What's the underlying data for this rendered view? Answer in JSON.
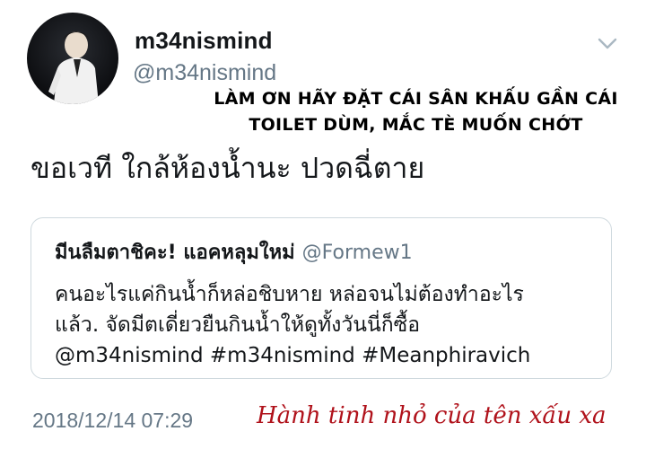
{
  "tweet": {
    "display_name": "m34nismind",
    "handle": "@m34nismind",
    "text": "ขอเวที ใกล้ห้องน้ำนะ ปวดฉี่ตาย",
    "timestamp": "2018/12/14 07:29",
    "avatar_icon": "profile-photo",
    "menu_icon": "chevron-down-icon"
  },
  "overlay": {
    "caption_line1": "LÀM ƠN HÃY ĐẶT CÁI SÂN KHẤU GẦN CÁI",
    "caption_line2": "TOILET DÙM, MẮC TÈ MUỐN CHỚT",
    "watermark": "Hành tinh nhỏ của tên xấu xa",
    "watermark_color": "#b0121b"
  },
  "quoted": {
    "name": "มีนลืมตาชิคะ! แอคหลุมใหม่",
    "handle": "@Formew1",
    "line1": "คนอะไรแค่กินน้ำก็หล่อชิบหาย หล่อจนไม่ต้องทำอะไร",
    "line2": "แล้ว. จัดมีตเดี่ยวยืนกินน้ำให้ดูทั้งวันนี่ก็ซื้อ",
    "line3": "@m34nismind #m34nismind #Meanphiravich"
  },
  "colors": {
    "text": "#14171a",
    "secondary": "#657786",
    "border": "#cfd9de"
  }
}
